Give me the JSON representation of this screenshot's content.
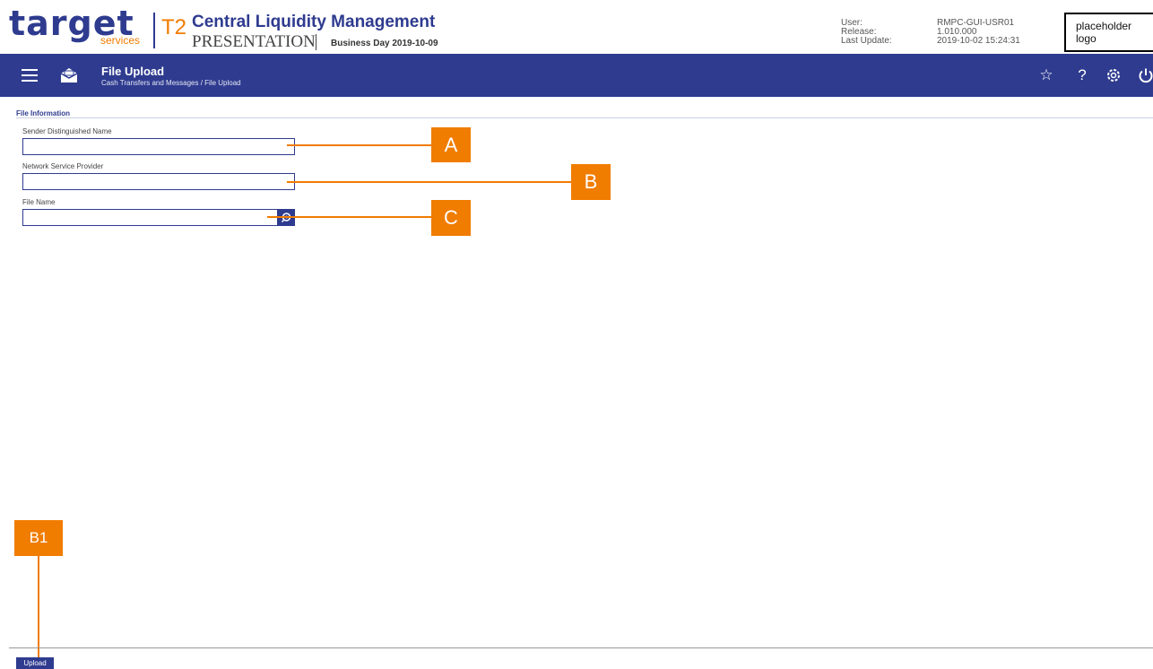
{
  "header": {
    "logo_word": "target",
    "logo_sub": "services",
    "t2_label": "T2",
    "app_title": "Central Liquidity Management",
    "environment": "PRESENTATION",
    "business_day": "Business Day 2019-10-09",
    "user_label": "User:",
    "release_label": "Release:",
    "last_update_label": "Last Update:",
    "user_value": "RMPC-GUI-USR01",
    "release_value": "1.010.000",
    "last_update_value": "2019-10-02 15:24:31",
    "placeholder_logo": "placeholder logo"
  },
  "nav": {
    "title": "File Upload",
    "breadcrumb": "Cash Transfers and Messages  /  File Upload",
    "icons": [
      "menu-icon",
      "mail-icon",
      "star-icon",
      "help-icon",
      "settings-icon",
      "power-icon"
    ]
  },
  "form": {
    "section_title": "File Information",
    "fields": [
      {
        "label": "Sender Distinguished Name",
        "value": ""
      },
      {
        "label": "Network Service Provider",
        "value": ""
      },
      {
        "label": "File Name",
        "value": ""
      }
    ]
  },
  "callouts": {
    "a": "A",
    "b": "B",
    "c": "C",
    "b1": "B1"
  },
  "footer": {
    "upload_label": "Upload"
  },
  "colors": {
    "primary": "#2e3b8f",
    "accent": "#f07c00"
  }
}
